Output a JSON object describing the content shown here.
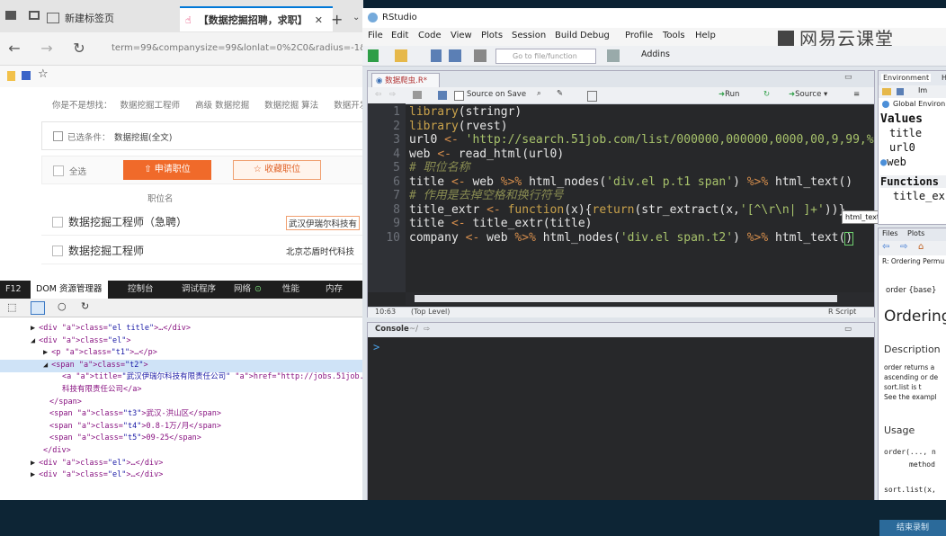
{
  "watermark": "网易云课堂",
  "browser": {
    "tabs": [
      {
        "label": "新建标签页"
      },
      {
        "label": "【数据挖掘招聘，求职】"
      }
    ],
    "new_tab": "+",
    "url": "term=99&companysize=99&lonlat=0%2C0&radius=-1&ord_f",
    "page": {
      "related_prefix": "你是不是想找：",
      "related": [
        "数据挖掘工程师",
        "高级 数据挖掘",
        "数据挖掘 算法",
        "数据开发"
      ],
      "selected_label": "已选条件：",
      "selected_value": "数据挖掘(全文)",
      "select_all": "全选",
      "apply_button": "申请职位",
      "fav_button": "收藏职位",
      "col_header": "职位名",
      "rows": [
        {
          "title": "数据挖掘工程师（急聘）",
          "company": "武汉伊瑞尔科技有"
        },
        {
          "title": "数据挖掘工程师",
          "company": "北京芯盾时代科技"
        }
      ]
    }
  },
  "devtools": {
    "tabs": [
      "F12",
      "DOM 资源管理器",
      "控制台",
      "调试程序",
      "网络",
      "性能",
      "内存"
    ],
    "dom_lines": [
      {
        "indent": 4,
        "arrow": "▶",
        "html": "<div class=\"el title\">…</div>"
      },
      {
        "indent": 4,
        "arrow": "◢",
        "html": "<div class=\"el\">"
      },
      {
        "indent": 6,
        "arrow": "▶",
        "html": "<p class=\"t1\">…</p>"
      },
      {
        "indent": 6,
        "arrow": "◢",
        "html": "<span class=\"t2\">"
      },
      {
        "indent": 9,
        "arrow": "",
        "html": "<a title=\"武汉伊瑞尔科技有限责任公司\" href=\"http://jobs.51job.co"
      },
      {
        "indent": 9,
        "arrow": "",
        "html": "科技有限责任公司</a>"
      },
      {
        "indent": 7,
        "arrow": "",
        "html": "</span>"
      },
      {
        "indent": 7,
        "arrow": "",
        "html": "<span class=\"t3\">武汉-洪山区</span>"
      },
      {
        "indent": 7,
        "arrow": "",
        "html": "<span class=\"t4\">0.8-1万/月</span>"
      },
      {
        "indent": 7,
        "arrow": "",
        "html": "<span class=\"t5\">09-25</span>"
      },
      {
        "indent": 6,
        "arrow": "",
        "html": "</div>"
      },
      {
        "indent": 4,
        "arrow": "▶",
        "html": "<div class=\"el\">…</div>"
      },
      {
        "indent": 4,
        "arrow": "▶",
        "html": "<div class=\"el\">…</div>"
      }
    ]
  },
  "rstudio": {
    "title": "RStudio",
    "menu": [
      "File",
      "Edit",
      "Code",
      "View",
      "Plots",
      "Session",
      "Build",
      "Debug",
      "Profile",
      "Tools",
      "Help"
    ],
    "goto_placeholder": "Go to file/function",
    "addins": "Addins",
    "editor": {
      "tab": "数据爬虫.R*",
      "source_on_save": "Source on Save",
      "run": "Run",
      "source": "Source",
      "lines": [
        {
          "n": "1",
          "code": "library(stringr)"
        },
        {
          "n": "2",
          "code": "library(rvest)"
        },
        {
          "n": "3",
          "code": "url0 <- 'http://search.51job.com/list/000000,000000,0000,00,9,99,%"
        },
        {
          "n": "4",
          "code": "web <- read_html(url0)"
        },
        {
          "n": "5",
          "code": "# 职位名称"
        },
        {
          "n": "6",
          "code": "title <- web %>% html_nodes('div.el p.t1 span') %>% html_text()"
        },
        {
          "n": "7",
          "code": "# 作用是去掉空格和换行符号"
        },
        {
          "n": "8",
          "code": "title_extr <- function(x){return(str_extract(x,'[^\\r\\n| ]+'))}"
        },
        {
          "n": "9",
          "code": "title <- title_extr(title)"
        },
        {
          "n": "10",
          "code": "company <- web %>% html_nodes('div.el span.t2') %>% html_text()"
        }
      ],
      "tooltip": "html_text(x, trim = FALSE)",
      "status_pos": "10:63",
      "status_level": "(Top Level)",
      "status_type": "R Script"
    },
    "console": {
      "title": "Console",
      "path": "~/",
      "prompt": ">"
    },
    "environment": {
      "tabs": [
        "Environment",
        "H"
      ],
      "import": "Im",
      "global": "Global Environ",
      "values_header": "Values",
      "values": [
        "title",
        "url0",
        "web"
      ],
      "functions_header": "Functions",
      "functions": [
        "title_ex"
      ]
    },
    "help": {
      "tabs": [
        "Files",
        "Plots"
      ],
      "crumb": "R: Ordering Permu",
      "pkg": "order {base}",
      "title": "Ordering",
      "desc_h": "Description",
      "desc_lines": [
        "order returns a",
        "ascending or de",
        "sort.list is t",
        "See the exampl"
      ],
      "usage_h": "Usage",
      "usage_lines": [
        "order(..., n",
        "method",
        "sort.list(x,"
      ]
    }
  },
  "taskbar": {
    "corner_label": "结束录制"
  }
}
